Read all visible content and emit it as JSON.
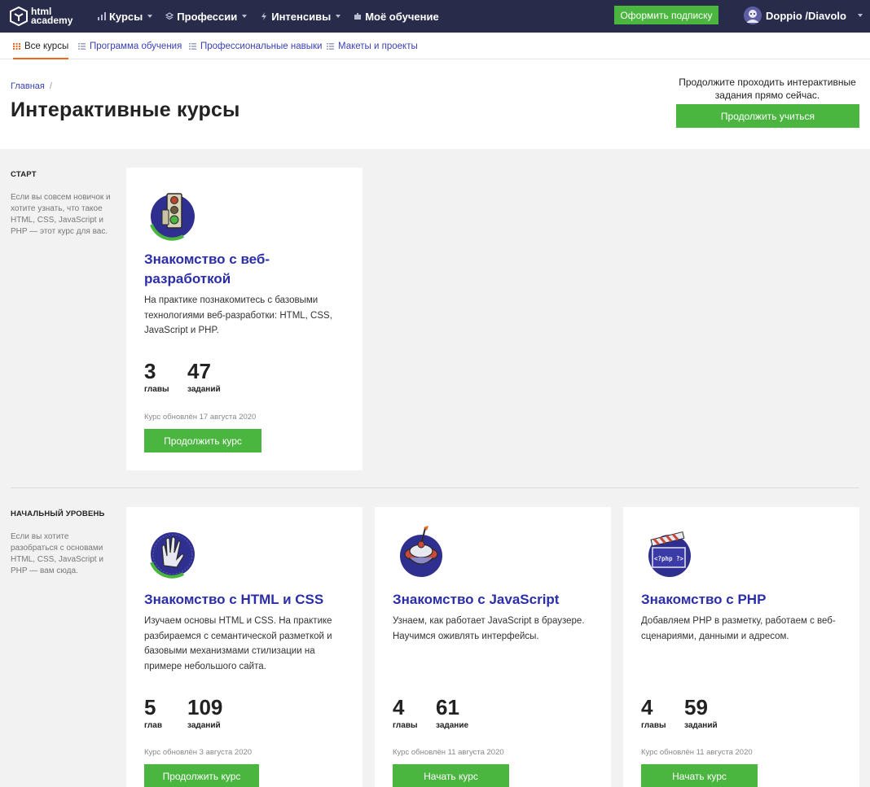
{
  "topbar": {
    "logo_line1": "html",
    "logo_line2": "academy",
    "nav": [
      {
        "label": "Курсы",
        "icon": "bar-chart-icon"
      },
      {
        "label": "Профессии",
        "icon": "layers-icon"
      },
      {
        "label": "Интенсивы",
        "icon": "lightning-icon"
      },
      {
        "label": "Моё обучение",
        "icon": "puzzle-icon"
      }
    ],
    "subscribe_label": "Оформить подписку",
    "user_name": "Doppio /Diavolo"
  },
  "subnav": [
    {
      "label": "Все курсы"
    },
    {
      "label": "Программа обучения"
    },
    {
      "label": "Профессиональные навыки"
    },
    {
      "label": "Макеты и проекты"
    }
  ],
  "header": {
    "breadcrumb": "Главная",
    "breadcrumb_sep": "/",
    "title": "Интерактивные курсы",
    "promo_text": "Продолжите проходить интерактивные задания прямо сейчас.",
    "promo_button": "Продолжить учиться"
  },
  "sections": [
    {
      "label": "СТАРТ",
      "description": "Если вы совсем новичок и хотите узнать, что такое HTML, CSS, JavaScript и PHP — этот курс для вас.",
      "cards": [
        {
          "title": "Знакомство с веб-разработкой",
          "description": "На практике познакомитесь с базовыми технологиями веб-разработки: HTML, CSS, JavaScript и PHP.",
          "stat1_num": "3",
          "stat1_label": "главы",
          "stat2_num": "47",
          "stat2_label": "заданий",
          "updated": "Курс обновлён 17 августа 2020",
          "button": "Продолжить курс",
          "icon": "traffic-light-icon"
        }
      ]
    },
    {
      "label": "НАЧАЛЬНЫЙ УРОВЕНЬ",
      "description": "Если вы хотите разобраться с основами HTML, CSS, JavaScript и PHP — вам сюда.",
      "cards": [
        {
          "title": "Знакомство с HTML и CSS",
          "description": "Изучаем основы HTML и CSS. На практике разбираемся с семантической разметкой и базовыми механизмами стилизации на примере небольшого сайта.",
          "stat1_num": "5",
          "stat1_label": "глав",
          "stat2_num": "109",
          "stat2_label": "заданий",
          "updated": "Курс обновлён 3 августа 2020",
          "button": "Продолжить курс",
          "icon": "vulcan-hand-icon"
        },
        {
          "title": "Знакомство с JavaScript",
          "description": "Узнаем, как работает JavaScript в браузере. Научимся оживлять интерфейсы.",
          "stat1_num": "4",
          "stat1_label": "главы",
          "stat2_num": "61",
          "stat2_label": "задание",
          "updated": "Курс обновлён 11 августа 2020",
          "button": "Начать курс",
          "icon": "spinning-top-icon"
        },
        {
          "title": "Знакомство с PHP",
          "description": "Добавляем PHP в разметку, работаем с веб-сценариями, данными и адресом.",
          "stat1_num": "4",
          "stat1_label": "главы",
          "stat2_num": "59",
          "stat2_label": "заданий",
          "updated": "Курс обновлён 11 августа 2020",
          "button": "Начать курс",
          "icon": "clapperboard-icon",
          "icon_text": "<?php ?>"
        }
      ]
    }
  ],
  "colors": {
    "topbar": "#282b4a",
    "accent_green": "#4ab640",
    "title_blue": "#2b2ea8",
    "link_blue": "#3b41b8",
    "active_orange": "#f0661f"
  }
}
